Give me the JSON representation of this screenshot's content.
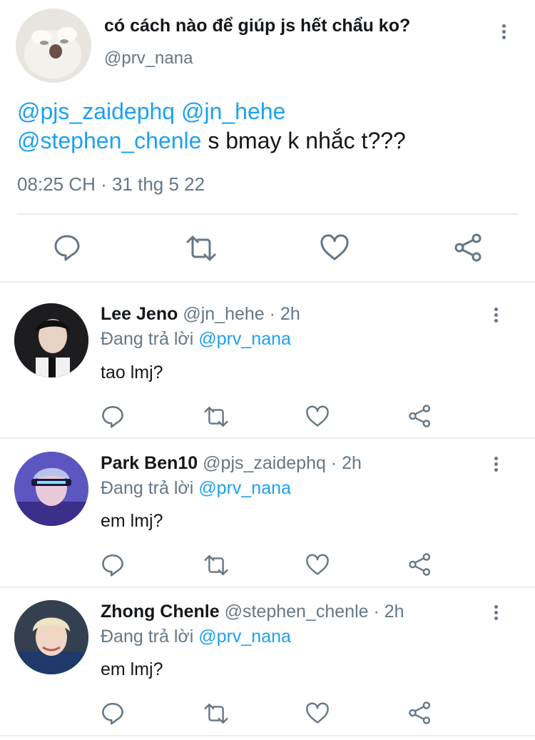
{
  "main_tweet": {
    "display_name": "có cách nào để giúp js hết chẩu ko?",
    "handle": "@prv_nana",
    "mention_1": "@pjs_zaidephq",
    "mention_2": "@jn_hehe",
    "mention_3": "@stephen_chenle",
    "body_text": "s bmay k nhắc t???",
    "timestamp": "08:25 CH · 31 thg 5 22"
  },
  "replies": [
    {
      "display_name": "Lee Jeno",
      "handle": "@jn_hehe",
      "time": "· 2h",
      "replying_prefix": "Đang trả lời",
      "replying_to": "@prv_nana",
      "text": "tao lmj?"
    },
    {
      "display_name": "Park Ben10",
      "handle": "@pjs_zaidephq",
      "time": "· 2h",
      "replying_prefix": "Đang trả lời",
      "replying_to": "@prv_nana",
      "text": "em lmj?"
    },
    {
      "display_name": "Zhong Chenle",
      "handle": "@stephen_chenle",
      "time": "· 2h",
      "replying_prefix": "Đang trả lời",
      "replying_to": "@prv_nana",
      "text": "em lmj?"
    }
  ],
  "icons": [
    "reply-icon",
    "retweet-icon",
    "like-icon",
    "share-icon",
    "more-options-icon"
  ],
  "colors": {
    "accent": "#1da1f2",
    "secondary_text": "#657786",
    "divider": "#e6ecf0"
  }
}
